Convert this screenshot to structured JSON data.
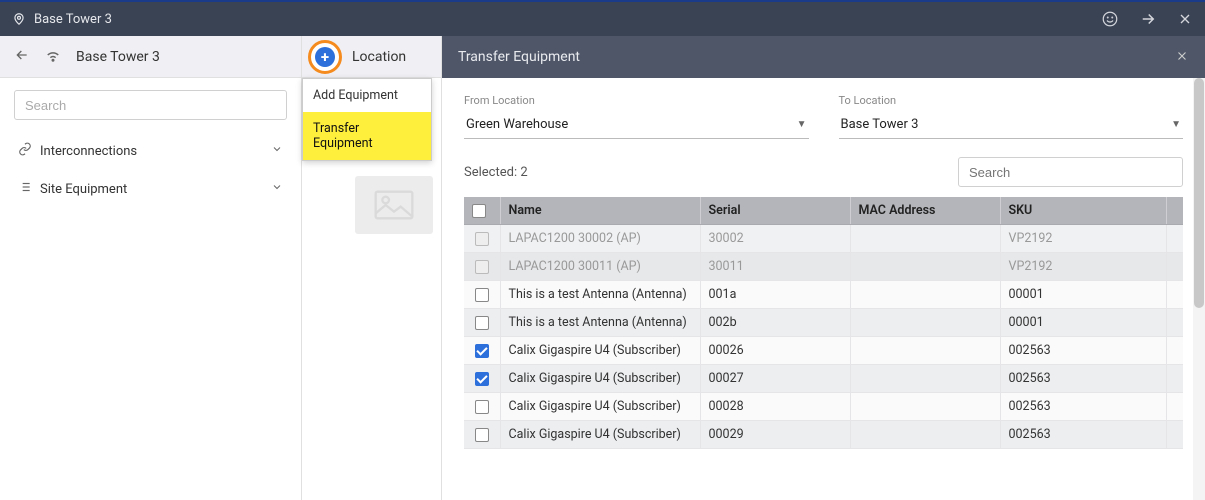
{
  "topbar": {
    "title": "Base Tower 3"
  },
  "sidebar": {
    "site_name": "Base Tower 3",
    "search_placeholder": "Search",
    "sections": [
      {
        "label": "Interconnections"
      },
      {
        "label": "Site Equipment"
      }
    ]
  },
  "middle": {
    "title": "Location",
    "menu": {
      "item0": "Add Equipment",
      "item1": "Transfer Equipment"
    }
  },
  "panel": {
    "title": "Transfer Equipment",
    "from_label": "From Location",
    "from_value": "Green Warehouse",
    "to_label": "To Location",
    "to_value": "Base Tower 3",
    "selected_label": "Selected: 2",
    "search_placeholder": "Search",
    "columns": {
      "name": "Name",
      "serial": "Serial",
      "mac": "MAC Address",
      "sku": "SKU"
    },
    "rows": [
      {
        "name": "LAPAC1200 30002 (AP)",
        "serial": "30002",
        "mac": "",
        "sku": "VP2192",
        "checked": false,
        "disabled": true
      },
      {
        "name": "LAPAC1200 30011 (AP)",
        "serial": "30011",
        "mac": "",
        "sku": "VP2192",
        "checked": false,
        "disabled": true
      },
      {
        "name": "This is a test Antenna (Antenna)",
        "serial": "001a",
        "mac": "",
        "sku": "00001",
        "checked": false,
        "disabled": false
      },
      {
        "name": "This is a test Antenna (Antenna)",
        "serial": "002b",
        "mac": "",
        "sku": "00001",
        "checked": false,
        "disabled": false
      },
      {
        "name": "Calix Gigaspire U4 (Subscriber)",
        "serial": "00026",
        "mac": "",
        "sku": "002563",
        "checked": true,
        "disabled": false
      },
      {
        "name": "Calix Gigaspire U4 (Subscriber)",
        "serial": "00027",
        "mac": "",
        "sku": "002563",
        "checked": true,
        "disabled": false
      },
      {
        "name": "Calix Gigaspire U4 (Subscriber)",
        "serial": "00028",
        "mac": "",
        "sku": "002563",
        "checked": false,
        "disabled": false
      },
      {
        "name": "Calix Gigaspire U4 (Subscriber)",
        "serial": "00029",
        "mac": "",
        "sku": "002563",
        "checked": false,
        "disabled": false
      }
    ]
  }
}
